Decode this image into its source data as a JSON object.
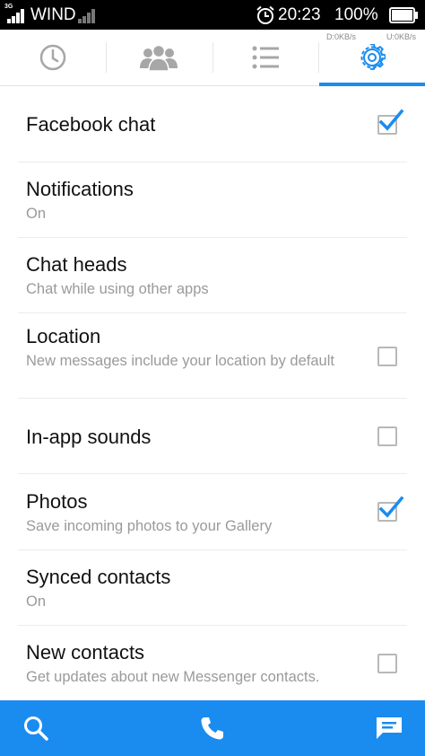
{
  "status_bar": {
    "network_type": "3G",
    "carrier": "WIND",
    "time": "20:23",
    "battery_percent": "100%",
    "battery_level": 1.0
  },
  "tabs": {
    "download_speed": "D:0KB/s",
    "upload_speed": "U:0KB/s",
    "items": [
      {
        "icon": "clock-icon",
        "selected": false
      },
      {
        "icon": "people-icon",
        "selected": false
      },
      {
        "icon": "list-icon",
        "selected": false
      },
      {
        "icon": "gear-icon",
        "selected": true
      }
    ],
    "accent_color": "#1a8cf0"
  },
  "settings": [
    {
      "title": "Facebook chat",
      "subtitle": "",
      "control": "checkbox",
      "checked": true
    },
    {
      "title": "Notifications",
      "subtitle": "On",
      "control": "none",
      "checked": false
    },
    {
      "title": "Chat heads",
      "subtitle": "Chat while using other apps",
      "control": "none",
      "checked": false
    },
    {
      "title": "Location",
      "subtitle": "New messages include your location by default",
      "control": "checkbox",
      "checked": false
    },
    {
      "title": "In-app sounds",
      "subtitle": "",
      "control": "checkbox",
      "checked": false
    },
    {
      "title": "Photos",
      "subtitle": "Save incoming photos to your Gallery",
      "control": "checkbox",
      "checked": true
    },
    {
      "title": "Synced contacts",
      "subtitle": "On",
      "control": "none",
      "checked": false
    },
    {
      "title": "New contacts",
      "subtitle": "Get updates about new Messenger contacts.",
      "control": "checkbox",
      "checked": false
    }
  ],
  "bottom_bar": {
    "buttons": [
      {
        "icon": "search-icon"
      },
      {
        "icon": "phone-icon"
      },
      {
        "icon": "compose-message-icon"
      }
    ],
    "color": "#1a8cf0"
  }
}
